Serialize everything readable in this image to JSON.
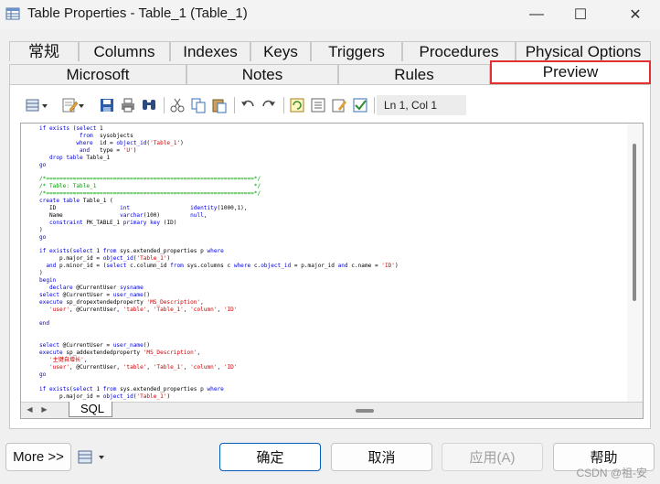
{
  "window": {
    "title": "Table Properties - Table_1 (Table_1)",
    "controls": {
      "minimize": "—",
      "maximize": "☐",
      "close": "✕"
    }
  },
  "tabs_row1": [
    "常规",
    "Columns",
    "Indexes",
    "Keys",
    "Triggers",
    "Procedures",
    "Physical Options"
  ],
  "tabs_row2": [
    "Microsoft",
    "Notes",
    "Rules",
    "Preview"
  ],
  "active_tab": "Preview",
  "toolbar": {
    "cursor_position": "Ln 1, Col 1",
    "icons": [
      "database-dropdown-icon",
      "edit-dropdown-icon",
      "save-icon",
      "print-icon",
      "find-icon",
      "cut-icon",
      "copy-icon",
      "paste-icon",
      "undo-icon",
      "redo-icon",
      "refresh-icon",
      "list-icon",
      "notepad-icon",
      "checklist-icon"
    ]
  },
  "editor": {
    "tab_label": "SQL",
    "lines": [
      "if exists (select 1",
      "            from  sysobjects",
      "           where  id = object_id('Table_1')",
      "            and   type = 'U')",
      "   drop table Table_1",
      "go",
      "",
      "/*==============================================================*/",
      "/* Table: Table_1                                               */",
      "/*==============================================================*/",
      "create table Table_1 (",
      "   ID                   int                  identity(1000,1),",
      "   Name                 varchar(100)         null,",
      "   constraint PK_TABLE_1 primary key (ID)",
      ")",
      "go",
      "",
      "if exists(select 1 from sys.extended_properties p where",
      "      p.major_id = object_id('Table_1')",
      "  and p.minor_id = (select c.column_id from sys.columns c where c.object_id = p.major_id and c.name = 'ID')",
      ")",
      "begin",
      "   declare @CurrentUser sysname",
      "select @CurrentUser = user_name()",
      "execute sp_dropextendedproperty 'MS_Description',",
      "   'user', @CurrentUser, 'table', 'Table_1', 'column', 'ID'",
      "",
      "end",
      "",
      "",
      "select @CurrentUser = user_name()",
      "execute sp_addextendedproperty 'MS_Description',",
      "   '主键自增长',",
      "   'user', @CurrentUser, 'table', 'Table_1', 'column', 'ID'",
      "go",
      "",
      "if exists(select 1 from sys.extended_properties p where",
      "      p.major_id = object_id('Table_1')"
    ]
  },
  "footer": {
    "more_button": "More >>",
    "options_icon": "table-options-icon",
    "ok": "确定",
    "cancel": "取消",
    "apply": "应用(A)",
    "help": "帮助"
  },
  "watermark": "CSDN @祖-安",
  "colors": {
    "active_tab_border": "#e03030",
    "ok_border": "#005fb8",
    "keyword": "#0000dd",
    "string": "#cc0000",
    "comment": "#00a000"
  }
}
